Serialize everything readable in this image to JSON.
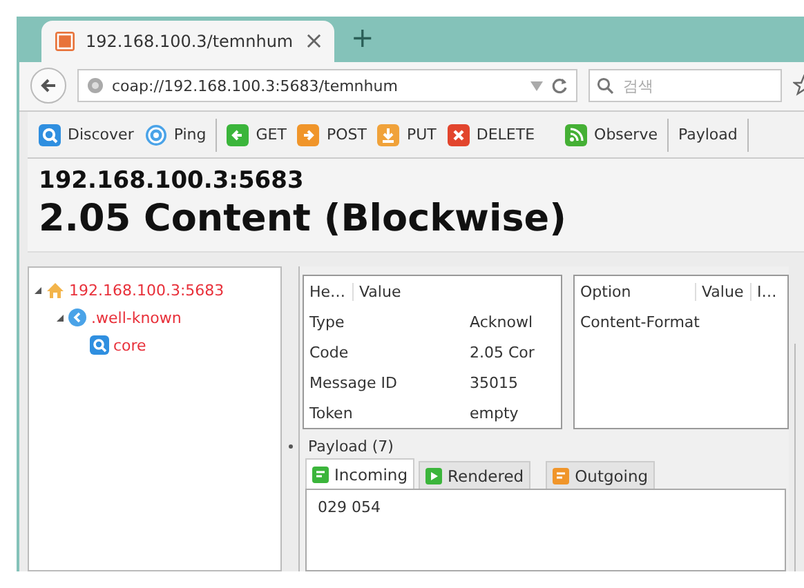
{
  "browser_tab": {
    "title": "192.168.100.3/temnhum",
    "close": "×",
    "new_tab": "+"
  },
  "address_bar": {
    "url": "coap://192.168.100.3:5683/temnhum"
  },
  "search": {
    "placeholder": "검색"
  },
  "toolbar": {
    "buttons": [
      {
        "label": "Discover",
        "kind": "discover"
      },
      {
        "label": "Ping",
        "kind": "ping"
      },
      {
        "label": "GET",
        "kind": "get"
      },
      {
        "label": "POST",
        "kind": "post"
      },
      {
        "label": "PUT",
        "kind": "put"
      },
      {
        "label": "DELETE",
        "kind": "delete"
      },
      {
        "label": "Observe",
        "kind": "observe"
      },
      {
        "label": "Payload",
        "kind": "plain"
      }
    ]
  },
  "heading": {
    "host": "192.168.100.3:5683",
    "status": "2.05 Content (Blockwise)"
  },
  "tree": {
    "items": [
      {
        "label": "192.168.100.3:5683",
        "kind": "host",
        "expanded": true,
        "children": [
          {
            "label": ".well-known",
            "kind": "folder",
            "expanded": true,
            "children": [
              {
                "label": "core",
                "kind": "resource"
              }
            ]
          }
        ]
      }
    ]
  },
  "headers": {
    "columns": [
      "He…",
      "Value"
    ],
    "rows": [
      [
        "Type",
        "Acknowl"
      ],
      [
        "Code",
        "2.05 Cor"
      ],
      [
        "Message ID",
        "35015"
      ],
      [
        "Token",
        "empty"
      ]
    ]
  },
  "options": {
    "columns": [
      "Option",
      "Value",
      "I…"
    ],
    "rows": [
      {
        "option": "Content-Format"
      }
    ]
  },
  "payload": {
    "title": "Payload (7)",
    "tabs": [
      {
        "label": "Incoming",
        "kind": "incoming",
        "selected": true
      },
      {
        "label": "Rendered",
        "kind": "rendered",
        "selected": false
      },
      {
        "label": "Outgoing",
        "kind": "outgoing",
        "selected": false
      }
    ],
    "content": "029 054"
  }
}
